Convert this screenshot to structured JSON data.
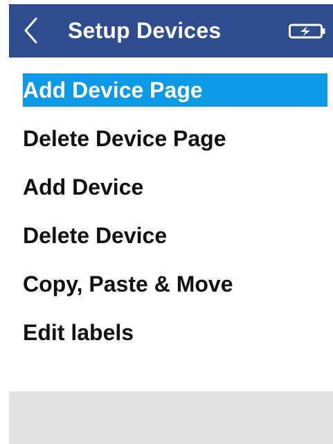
{
  "header": {
    "title": "Setup Devices",
    "back_icon": "chevron-left-icon",
    "battery_icon": "battery-charging-icon",
    "background_color": "#2f4d8e"
  },
  "menu": {
    "items": [
      {
        "label": "Add Device Page",
        "selected": true
      },
      {
        "label": "Delete Device Page",
        "selected": false
      },
      {
        "label": "Add Device",
        "selected": false
      },
      {
        "label": "Delete Device",
        "selected": false
      },
      {
        "label": "Copy, Paste & Move",
        "selected": false
      },
      {
        "label": "Edit labels",
        "selected": false
      }
    ],
    "selected_color": "#0c9ae6"
  },
  "footer": {
    "background_color": "#e2e2e2"
  }
}
